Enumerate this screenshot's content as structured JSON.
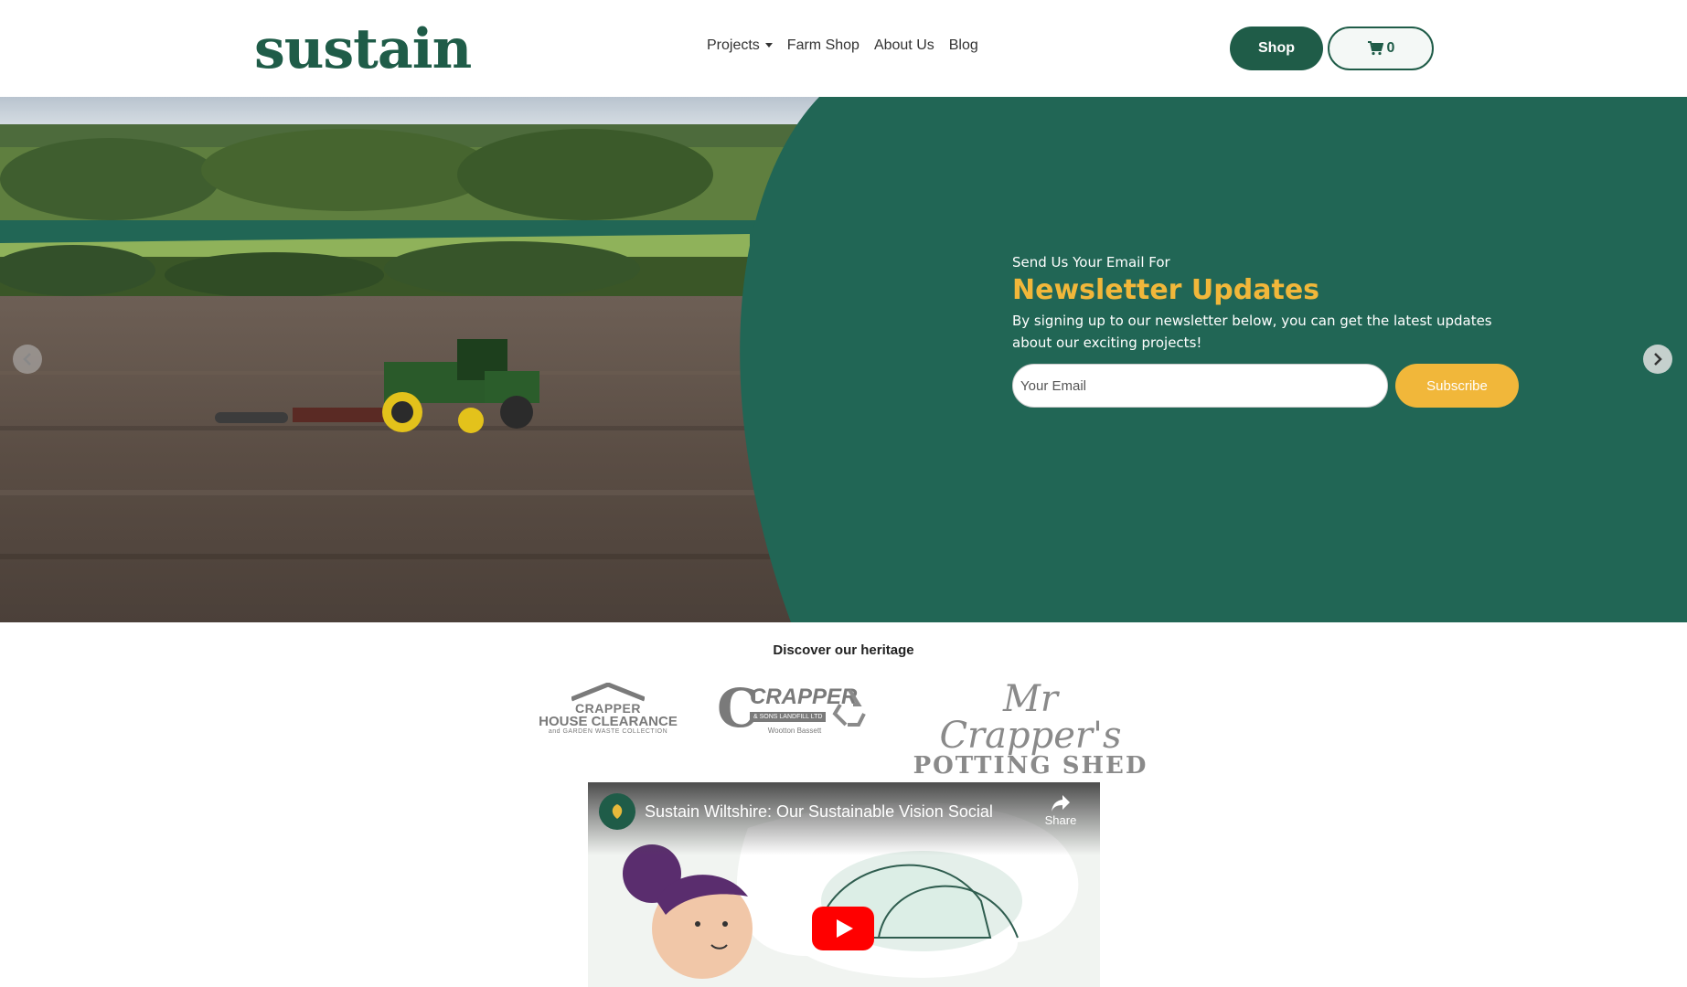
{
  "header": {
    "logo": "sustain",
    "nav": [
      {
        "label": "Projects",
        "has_dropdown": true
      },
      {
        "label": "Farm Shop"
      },
      {
        "label": "About Us"
      },
      {
        "label": "Blog"
      }
    ],
    "shop_label": "Shop",
    "cart_count": "0"
  },
  "newsletter": {
    "kicker": "Send Us Your Email For",
    "title": "Newsletter Updates",
    "body": "By signing up to our newsletter below, you can get the latest updates about our exciting projects!",
    "email_placeholder": "Your Email",
    "subscribe_label": "Subscribe"
  },
  "heritage": {
    "title": "Discover our heritage",
    "logos": [
      {
        "line1": "CRAPPER",
        "line2": "HOUSE CLEARANCE",
        "line3": "and GARDEN WASTE COLLECTION"
      },
      {
        "line1": "CRAPPER",
        "line2": "& SONS LANDFILL LTD",
        "line3": "Wootton Bassett"
      },
      {
        "line1": "Mr Crapper's",
        "line2": "POTTING SHED"
      }
    ]
  },
  "video": {
    "title": "Sustain Wiltshire: Our Sustainable Vision Social",
    "share_label": "Share"
  },
  "colors": {
    "brand_green": "#1f5c48",
    "hero_green": "#216655",
    "accent_yellow": "#f1b73a",
    "logo_gray": "#7a7a7a"
  }
}
